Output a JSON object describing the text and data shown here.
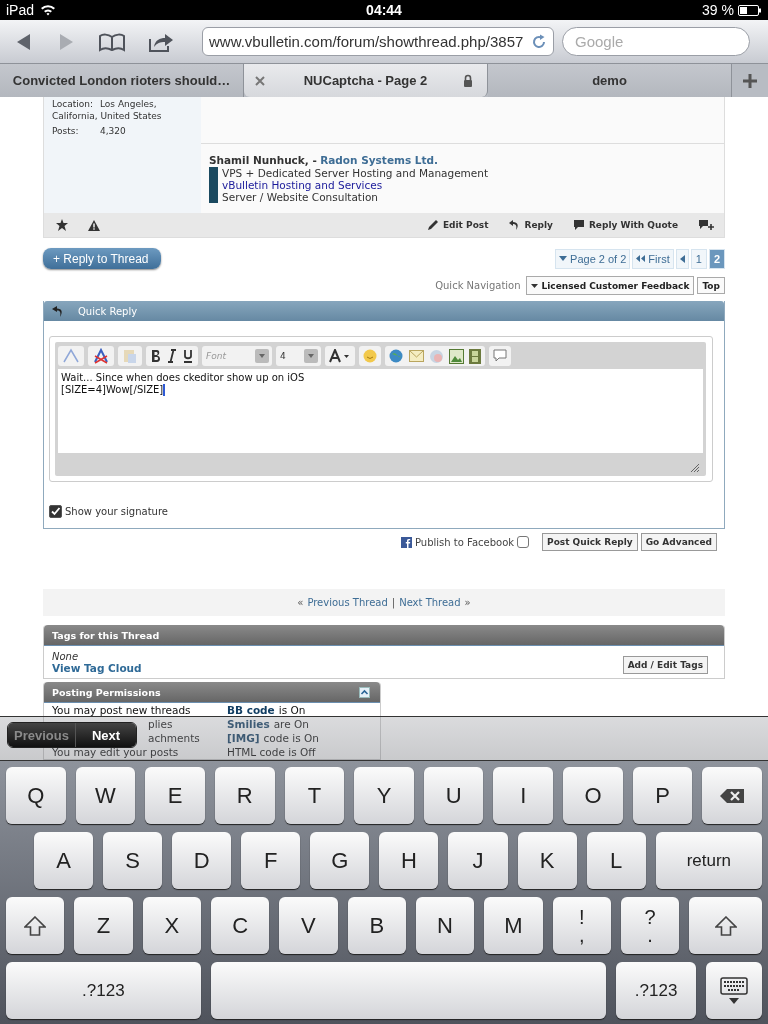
{
  "status_bar": {
    "device": "iPad",
    "time": "04:44",
    "battery": "39 %"
  },
  "browser": {
    "url": "www.vbulletin.com/forum/showthread.php/3857",
    "search": {
      "placeholder": "Google"
    }
  },
  "tabs": [
    {
      "title": "Convicted London rioters should…",
      "selected": false
    },
    {
      "title": "NUCaptcha - Page 2",
      "selected": true
    },
    {
      "title": "demo",
      "selected": false
    }
  ],
  "post": {
    "location": {
      "label": "Location:",
      "value": "Los Angeles,",
      "continuation": "California, United States"
    },
    "posts": {
      "label": "Posts:",
      "value": "4,320"
    }
  },
  "signature": {
    "name": "Shamil Nunhuck, -",
    "company": "Radon Systems Ltd.",
    "lines": [
      {
        "text": "VPS + Dedicated Server Hosting and Management",
        "kind": "text"
      },
      {
        "text": "vBulletin Hosting and Services",
        "kind": "link"
      },
      {
        "text": "Server / Website Consultation",
        "kind": "text"
      }
    ]
  },
  "post_actions": [
    {
      "label": "Edit Post",
      "kind": "edit"
    },
    {
      "label": "Reply",
      "kind": "reply"
    },
    {
      "label": "Reply With Quote",
      "kind": "quote"
    }
  ],
  "reply_to_thread": "+ Reply to Thread",
  "pagination": {
    "summary": "Page 2 of 2",
    "first": "First",
    "pages": [
      {
        "label": "1",
        "selected": false
      },
      {
        "label": "2",
        "selected": true
      }
    ]
  },
  "quick_navigation": {
    "label": "Quick Navigation",
    "menu": "Licensed Customer Feedback",
    "top": "Top"
  },
  "quick_reply": {
    "title": "Quick Reply",
    "font": {
      "placeholder": "Font"
    },
    "size": "4",
    "text_lines": [
      "Wait... Since when does ckeditor show up on iOS",
      "[SIZE=4]Wow[/SIZE]"
    ],
    "show_signature": {
      "label": "Show your signature",
      "checked": true
    }
  },
  "facebook": {
    "label": "Publish to Facebook",
    "checked": false
  },
  "buttons": [
    "Post Quick Reply",
    "Go Advanced"
  ],
  "thread_nav": {
    "open": "«",
    "previous": "Previous Thread",
    "separator": "|",
    "next": "Next Thread",
    "close": "»"
  },
  "tags": {
    "title": "Tags for this Thread",
    "none": "None",
    "cloud": "View Tag Cloud",
    "edit": "Add / Edit Tags"
  },
  "permissions": {
    "title": "Posting Permissions",
    "rows": [
      {
        "left": "You may post new threads",
        "kind": "full",
        "term": "BB code",
        "state": "is On"
      },
      {
        "left": "plies",
        "kind": "partial",
        "term": "Smilies",
        "state": "are On"
      },
      {
        "left": "achments",
        "kind": "partial",
        "term": "[IMG]",
        "state": "code is On"
      },
      {
        "left": "You may edit your posts",
        "kind": "full",
        "term": "",
        "state": "HTML code is Off"
      }
    ]
  },
  "form_assistant": {
    "previous": {
      "label": "Previous",
      "disabled": true
    },
    "next": {
      "label": "Next",
      "disabled": false
    }
  },
  "keyboard": {
    "rows": [
      [
        {
          "label": "Q",
          "kind": "letter"
        },
        {
          "label": "W",
          "kind": "letter"
        },
        {
          "label": "E",
          "kind": "letter"
        },
        {
          "label": "R",
          "kind": "letter"
        },
        {
          "label": "T",
          "kind": "letter"
        },
        {
          "label": "Y",
          "kind": "letter"
        },
        {
          "label": "U",
          "kind": "letter"
        },
        {
          "label": "I",
          "kind": "letter"
        },
        {
          "label": "O",
          "kind": "letter"
        },
        {
          "label": "P",
          "kind": "letter"
        },
        {
          "kind": "delete"
        }
      ],
      [
        {
          "label": "A",
          "kind": "letter"
        },
        {
          "label": "S",
          "kind": "letter"
        },
        {
          "label": "D",
          "kind": "letter"
        },
        {
          "label": "F",
          "kind": "letter"
        },
        {
          "label": "G",
          "kind": "letter"
        },
        {
          "label": "H",
          "kind": "letter"
        },
        {
          "label": "J",
          "kind": "letter"
        },
        {
          "label": "K",
          "kind": "letter"
        },
        {
          "label": "L",
          "kind": "letter"
        },
        {
          "label": "return",
          "kind": "return"
        }
      ],
      [
        {
          "kind": "shift"
        },
        {
          "label": "Z",
          "kind": "letter"
        },
        {
          "label": "X",
          "kind": "letter"
        },
        {
          "label": "C",
          "kind": "letter"
        },
        {
          "label": "V",
          "kind": "letter"
        },
        {
          "label": "B",
          "kind": "letter"
        },
        {
          "label": "N",
          "kind": "letter"
        },
        {
          "label": "M",
          "kind": "letter"
        },
        {
          "label": "!",
          "sub": ",",
          "kind": "punct"
        },
        {
          "label": "?",
          "sub": ".",
          "kind": "punct"
        },
        {
          "kind": "shift"
        }
      ]
    ],
    "bottom_keys": [
      {
        "label": ".?123",
        "kind": "numbers"
      },
      {
        "kind": "space"
      },
      {
        "label": ".?123",
        "kind": "numbers"
      },
      {
        "kind": "hide"
      }
    ]
  }
}
